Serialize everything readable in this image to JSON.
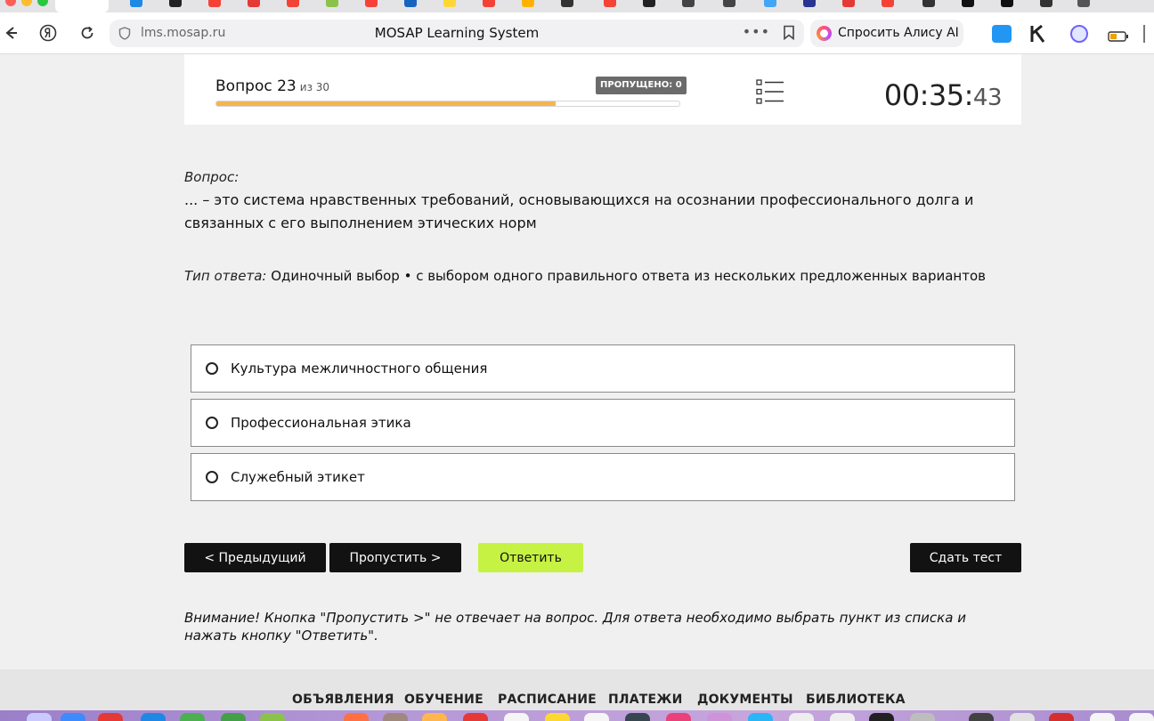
{
  "browser": {
    "url": "lms.mosap.ru",
    "page_title": "MOSAP Learning System",
    "alice_label": "Спросить Алису AI"
  },
  "quiz": {
    "question_label": "Вопрос 23",
    "question_of": "из 30",
    "skipped_label": "ПРОПУЩЕНО: 0",
    "progress_fraction": 0.733,
    "timer_main": "00:35:",
    "timer_seconds": "43"
  },
  "question": {
    "label": "Вопрос:",
    "text": "... – это система нравственных требований, основывающихся на осознании профессионального долга и связанных с его выполнением этических норм",
    "answer_type_label": "Тип ответа:",
    "answer_type_value": " Одиночный выбор • с выбором одного правильного ответа из нескольких предложенных вариантов"
  },
  "options": [
    "Культура межличностного общения",
    "Профессиональная этика",
    "Служебный этикет"
  ],
  "buttons": {
    "prev": "< Предыдущий",
    "skip": "Пропустить >",
    "answer": "Ответить",
    "submit": "Сдать тест"
  },
  "warning": "Внимание! Кнопка \"Пропустить >\" не отвечает на вопрос. Для ответа необходимо выбрать пункт из списка и нажать кнопку \"Ответить\".",
  "footer_nav": [
    "ОБЪЯВЛЕНИЯ",
    "ОБУЧЕНИЕ",
    "РАСПИСАНИЕ",
    "ПЛАТЕЖИ",
    "ДОКУМЕНТЫ",
    "БИБЛИОТЕКА"
  ],
  "colors": {
    "progress": "#f2b552",
    "answer_button": "#c6f243",
    "dark_button": "#121212",
    "badge": "#6b6b6b"
  }
}
